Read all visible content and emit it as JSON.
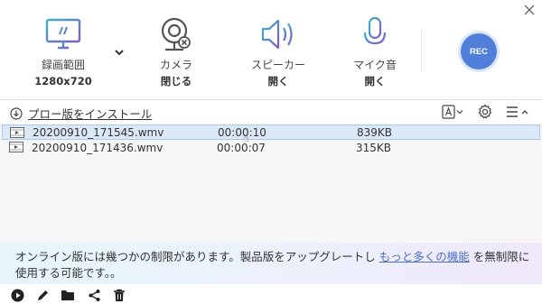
{
  "toolbar": {
    "record_area": {
      "label": "録画範囲",
      "value": "1280x720"
    },
    "camera": {
      "label": "カメラ",
      "value": "閉じる"
    },
    "speaker": {
      "label": "スピーカー",
      "value": "開く"
    },
    "microphone": {
      "label": "マイク音",
      "value": "開く"
    },
    "rec_label": "REC"
  },
  "install": {
    "link_text": "プロー版をインストール"
  },
  "files": [
    {
      "name": "20200910_171545.wmv",
      "duration": "00:00:10",
      "size": "839KB",
      "selected": true
    },
    {
      "name": "20200910_171436.wmv",
      "duration": "00:00:07",
      "size": "315KB",
      "selected": false
    }
  ],
  "promo": {
    "text_before": "オンライン版には幾つかの制限があります。製品版をアップグレートし ",
    "link_text": "もっと多くの機能",
    "text_after": " を無制限に使用する可能です。。"
  },
  "colors": {
    "accent": "#4f7fd8",
    "icon_teal": "#3aa0b8",
    "icon_purple": "#7d5cc7",
    "selection": "#dbe8f7"
  },
  "icons": [
    "close-icon",
    "monitor-icon",
    "chevron-down-icon",
    "webcam-icon",
    "speaker-icon",
    "microphone-icon",
    "download-icon",
    "text-format-icon",
    "gear-icon",
    "menu-icon",
    "video-file-icon",
    "play-icon",
    "edit-icon",
    "folder-icon",
    "share-icon",
    "trash-icon"
  ]
}
